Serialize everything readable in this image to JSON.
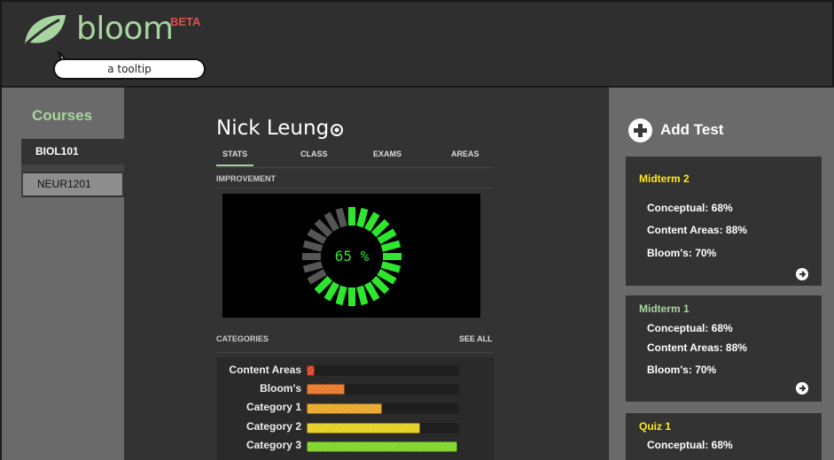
{
  "header": {
    "app_name": "bloom",
    "badge": "BETA",
    "tooltip": "a tooltip",
    "logo_icon": "leaf-icon",
    "brand_color": "#a8d4a0"
  },
  "sidebar": {
    "title": "Courses",
    "courses": [
      {
        "label": "BIOL101",
        "active": true
      },
      {
        "label": "NEUR1201",
        "active": false
      }
    ]
  },
  "student": {
    "name": "Nick Leung",
    "icon": "target-icon"
  },
  "tabs": [
    {
      "label": "STATS",
      "active": true
    },
    {
      "label": "CLASS",
      "active": false
    },
    {
      "label": "EXAMS",
      "active": false
    },
    {
      "label": "AREAS",
      "active": false
    }
  ],
  "improvement": {
    "label": "IMPROVEMENT",
    "percent_text": "65 %",
    "value": 65,
    "active_color": "#2ee62e",
    "inactive_color": "#555555"
  },
  "categories": {
    "label": "CATEGORIES",
    "see_all": "SEE ALL",
    "items": [
      {
        "label": "Content Areas",
        "value": 0.05,
        "color": "#e0462a"
      },
      {
        "label": "Bloom's",
        "value": 0.25,
        "color": "#e97a2a"
      },
      {
        "label": "Category 1",
        "value": 0.5,
        "color": "#e8a82a"
      },
      {
        "label": "Category 2",
        "value": 0.75,
        "color": "#e6cf22"
      },
      {
        "label": "Category 3",
        "value": 1.0,
        "color": "#7fd42a"
      }
    ]
  },
  "tests_panel": {
    "add_label": "Add Test",
    "tests": [
      {
        "title": "Midterm 2",
        "title_color": "#ffe81a",
        "lines": [
          "Conceptual: 68%",
          "Content Areas: 88%",
          "Bloom's: 70%"
        ]
      },
      {
        "title": "Midterm 1",
        "title_color": "#a8d4a0",
        "lines": [
          "Conceptual: 68%",
          "Content Areas: 88%",
          "Bloom's: 70%"
        ]
      },
      {
        "title": "Quiz 1",
        "title_color": "#ffe81a",
        "lines": [
          "Conceptual: 68%"
        ]
      }
    ]
  }
}
